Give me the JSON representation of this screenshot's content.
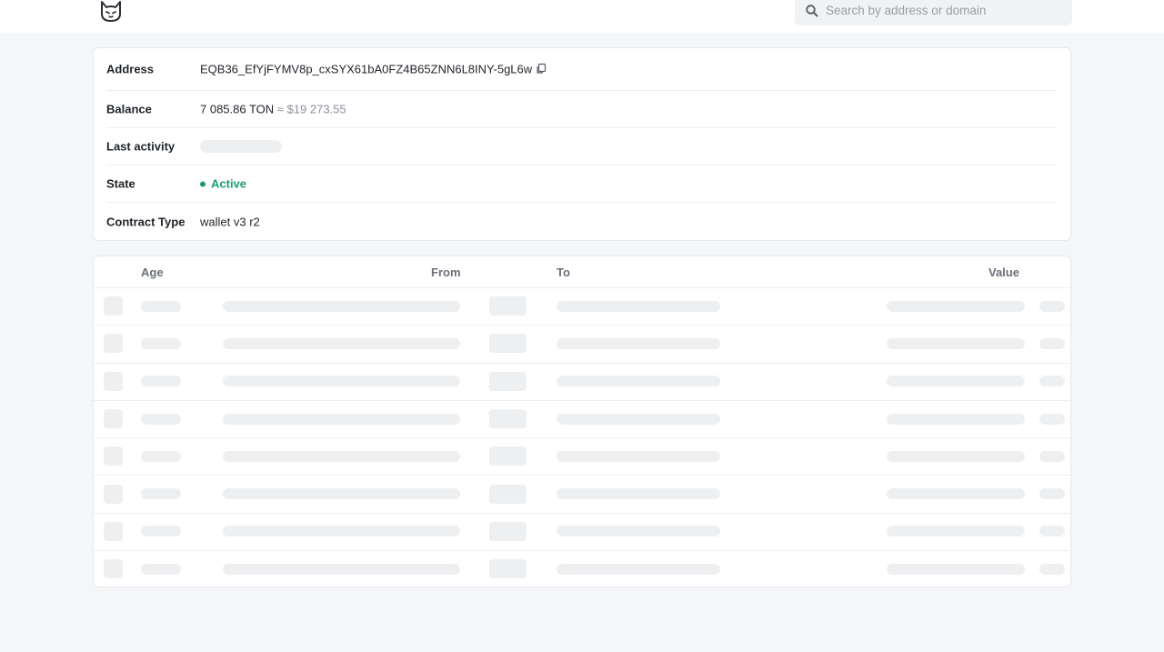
{
  "header": {
    "logo_icon": "cat-logo-icon",
    "search_icon": "search-icon",
    "search_placeholder": "Search by address or domain"
  },
  "address_info": {
    "address_label": "Address",
    "address_value": "EQB36_EfYjFYMV8p_cxSYX61bA0FZ4B65ZNN6L8INY-5gL6w",
    "copy_icon": "copy-icon",
    "balance_label": "Balance",
    "balance_value": "7 085.86 TON",
    "balance_usd": "≈ $19 273.55",
    "last_activity_label": "Last activity",
    "state_label": "State",
    "state_value": "Active",
    "state_color": "#1a9c74",
    "contract_type_label": "Contract Type",
    "contract_type_value": "wallet v3 r2"
  },
  "transactions": {
    "columns": {
      "age": "Age",
      "from": "From",
      "to": "To",
      "value": "Value"
    }
  },
  "colors": {
    "background": "#f5f6f8",
    "card": "#ffffff",
    "skeleton": "#eeeff1",
    "search_bg": "#f1f2f4"
  }
}
